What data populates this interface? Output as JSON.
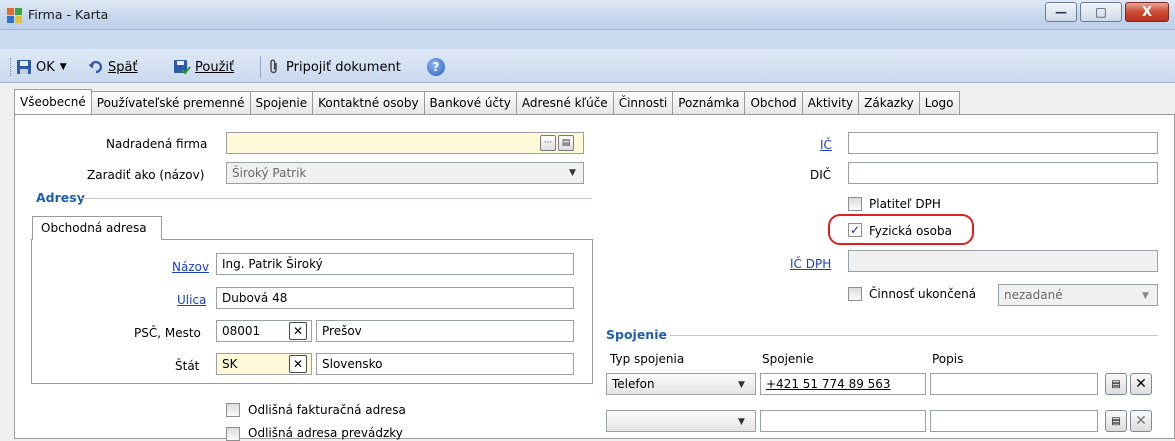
{
  "window": {
    "title": "Firma - Karta",
    "minimize_symbol": "—",
    "maximize_symbol": "□",
    "close_symbol": "X"
  },
  "toolbar": {
    "ok_label": "OK",
    "back_label": "Späť",
    "apply_label": "Použiť",
    "attach_label": "Pripojiť dokument"
  },
  "tabs": [
    "Všeobecné",
    "Používateľské premenné",
    "Spojenie",
    "Kontaktné osoby",
    "Bankové účty",
    "Adresné kľúče",
    "Činnosti",
    "Poznámka",
    "Obchod",
    "Aktivity",
    "Zákazky",
    "Logo"
  ],
  "general": {
    "parent_company_label": "Nadradená firma",
    "parent_company_value": "",
    "classify_as_label": "Zaradiť ako (názov)",
    "classify_as_value": "Široký Patrik",
    "ico_label": "IČ",
    "ico_value": "",
    "dic_label": "DIČ",
    "dic_value": "",
    "vat_payer_label": "Platiteľ DPH",
    "vat_payer_checked": false,
    "natural_person_label": "Fyzická osoba",
    "natural_person_checked": true,
    "ic_dph_label": "IČ DPH",
    "ic_dph_value": "",
    "activity_ended_label": "Činnosť ukončená",
    "activity_ended_checked": false,
    "activity_ended_value": "nezadané"
  },
  "addresses": {
    "section_title": "Adresy",
    "tab_label": "Obchodná adresa",
    "name_label": "Názov",
    "name_value": "Ing. Patrik Široký",
    "street_label": "Ulica",
    "street_value": "Dubová 48",
    "zip_city_label": "PSČ, Mesto",
    "zip_value": "08001",
    "city_value": "Prešov",
    "country_label": "Štát",
    "country_code": "SK",
    "country_name": "Slovensko",
    "different_billing_label": "Odlišná fakturačná adresa",
    "different_billing_checked": false,
    "different_operation_label": "Odlišná adresa prevádzky",
    "different_operation_checked": false
  },
  "contact": {
    "section_title": "Spojenie",
    "type_header": "Typ spojenia",
    "contact_header": "Spojenie",
    "description_header": "Popis",
    "rows": [
      {
        "type": "Telefon",
        "value": "+421 51 774 89 563",
        "description": ""
      },
      {
        "type": "",
        "value": "",
        "description": ""
      }
    ]
  },
  "colors": {
    "accent": "#1f5fb0",
    "link": "#1a3ec7",
    "highlight": "#e02020",
    "yellow_field": "#fff9d9"
  }
}
